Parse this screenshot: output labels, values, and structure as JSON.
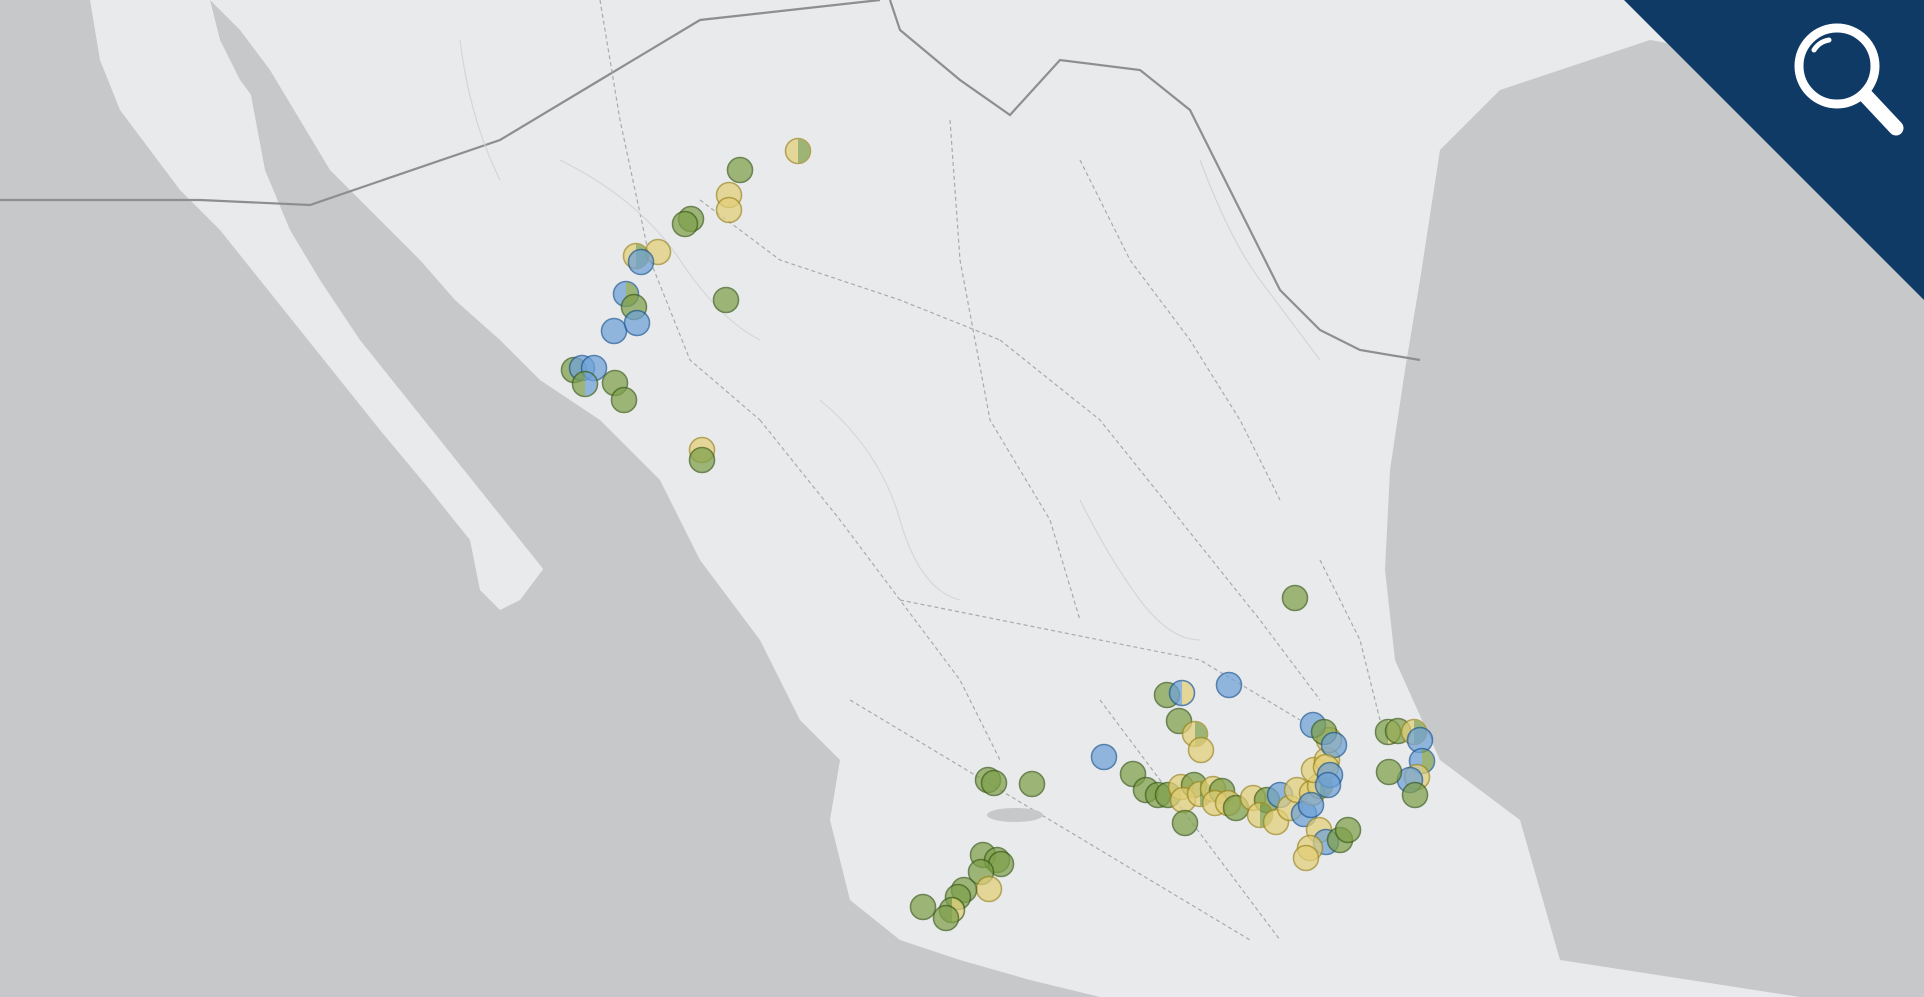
{
  "map": {
    "colors": {
      "water": "#c7c8ca",
      "land": "#e9eaeb",
      "country_border": "#8d8e90",
      "state_border": "#a9aaac",
      "river": "#d6d7d9"
    },
    "search_button": {
      "icon": "magnifier-icon",
      "background": "#0f3a66",
      "icon_color": "#ffffff"
    },
    "legend_colors": {
      "blue": {
        "fill": "#6fa2d8",
        "stroke": "#1f5a97"
      },
      "green": {
        "fill": "#7fa04a",
        "stroke": "#3d5e1a"
      },
      "yellow": {
        "fill": "#e2cf78",
        "stroke": "#a08a22"
      }
    }
  }
}
